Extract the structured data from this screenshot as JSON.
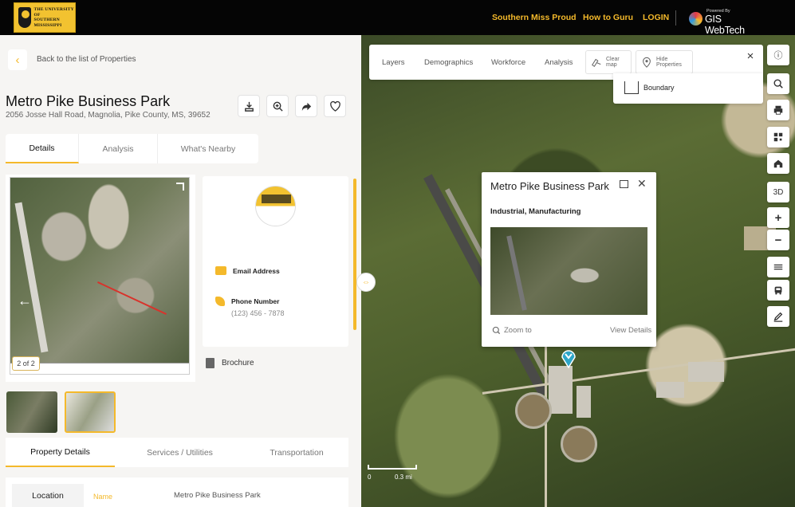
{
  "header": {
    "logo_text": [
      "THE UNIVERSITY OF",
      "SOUTHERN",
      "MISSISSIPPI"
    ],
    "nav": [
      "Southern Miss Proud",
      "How to Guru",
      "LOGIN"
    ],
    "brand_small": "Powered By",
    "brand_name": "GIS WebTech"
  },
  "left": {
    "back_label": "Back to the list of Properties",
    "title": "Metro Pike Business Park",
    "address": "2056 Josse Hall Road, Magnolia, Pike County, MS, 39652",
    "actions": [
      "download-icon",
      "zoom-in-icon",
      "share-icon",
      "heart-icon"
    ],
    "tabs": [
      "Details",
      "Analysis",
      "What's Nearby"
    ],
    "gallery": {
      "counter": "2 of 2"
    },
    "contact": {
      "email_label": "Email Address",
      "phone_label": "Phone Number",
      "phone": "(123) 456 - 7878"
    },
    "brochure": "Brochure",
    "detail_tabs": [
      "Property Details",
      "Services / Utilities",
      "Transportation"
    ],
    "location": {
      "section": "Location",
      "name_label": "Name",
      "name_value": "Metro Pike Business Park"
    }
  },
  "map": {
    "tabs": [
      "Layers",
      "Demographics",
      "Workforce",
      "Analysis"
    ],
    "clear_map": [
      "Clear",
      "map"
    ],
    "hide_properties": [
      "Hide",
      "Properties"
    ],
    "boundary": "Boundary",
    "right_tools": [
      "info-icon",
      "search-icon",
      "print-icon",
      "qr-icon",
      "home-icon",
      "3D",
      "zoom-in",
      "zoom-out",
      "layers-icon",
      "bus-icon",
      "pencil-icon"
    ],
    "popup": {
      "title": "Metro Pike Business Park",
      "subtitle": "Industrial, Manufacturing",
      "zoom": "Zoom to",
      "view": "View Details"
    },
    "scale": {
      "left": "0",
      "right": "0.3 mi"
    }
  }
}
